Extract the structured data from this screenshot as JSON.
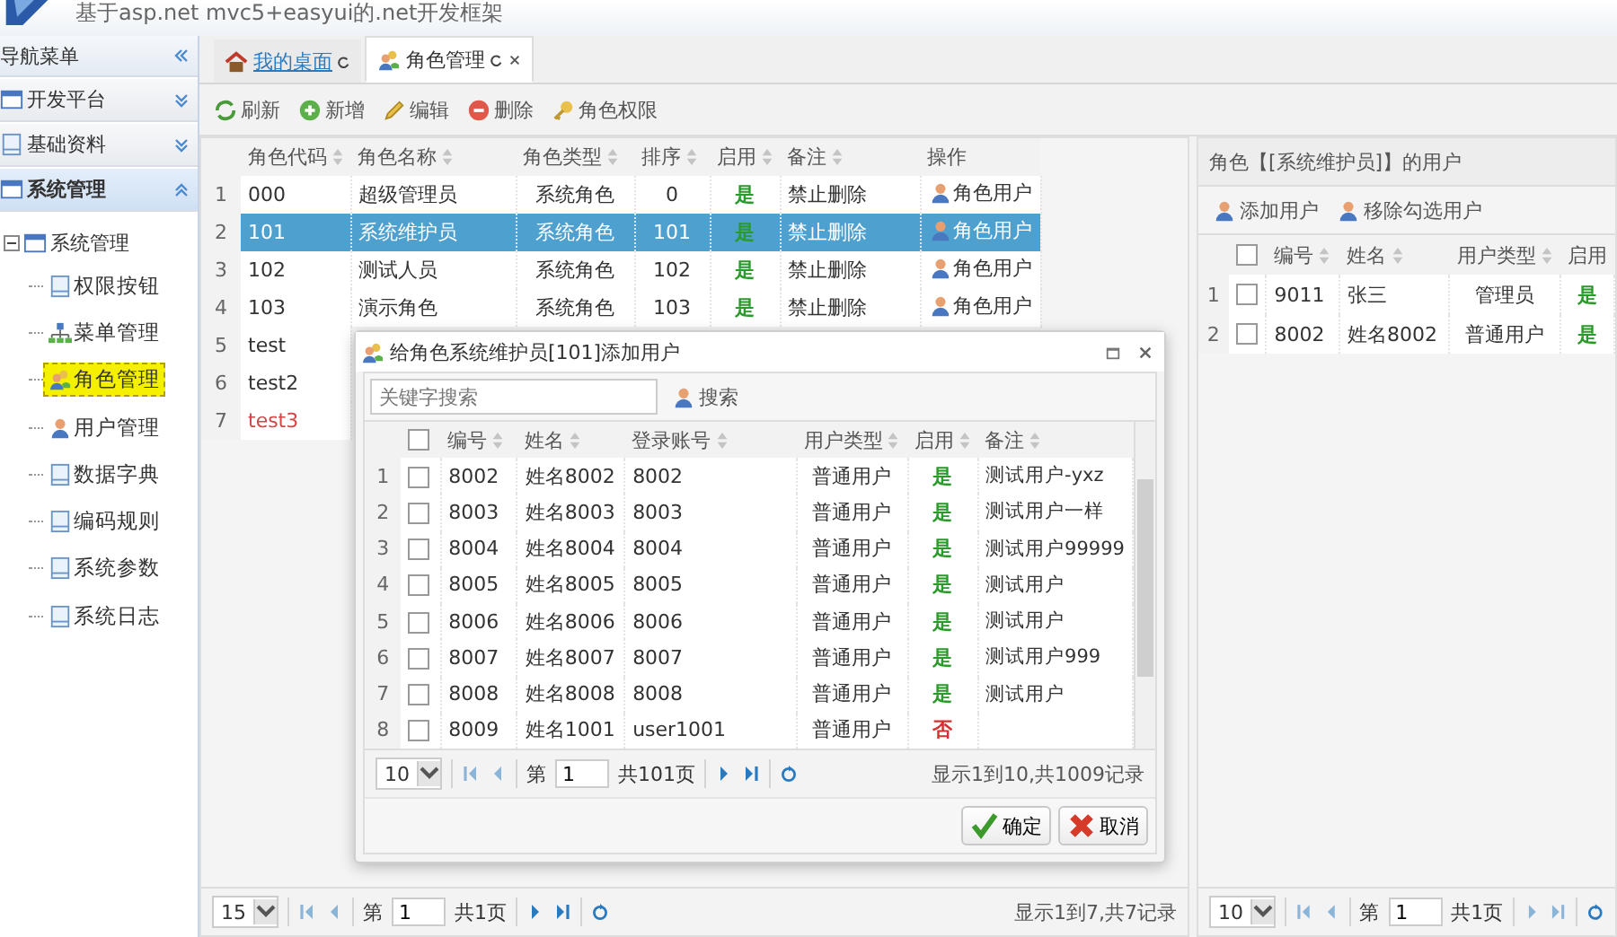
{
  "header": {
    "title": "基于asp.net mvc5+easyui的.net开发框架"
  },
  "sidebar": {
    "title": "导航菜单",
    "accordion": [
      {
        "label": "开发平台",
        "expanded": false
      },
      {
        "label": "基础资料",
        "expanded": false
      },
      {
        "label": "系统管理",
        "expanded": true
      }
    ],
    "tree": {
      "label": "系统管理",
      "expanded": true,
      "children": [
        {
          "label": "权限按钮",
          "selected": false
        },
        {
          "label": "菜单管理",
          "selected": false
        },
        {
          "label": "角色管理",
          "selected": true
        },
        {
          "label": "用户管理",
          "selected": false
        },
        {
          "label": "数据字典",
          "selected": false
        },
        {
          "label": "编码规则",
          "selected": false
        },
        {
          "label": "系统参数",
          "selected": false
        },
        {
          "label": "系统日志",
          "selected": false
        }
      ]
    }
  },
  "tabs": [
    {
      "label": "我的桌面",
      "selected": false,
      "closable": false
    },
    {
      "label": "角色管理",
      "selected": true,
      "closable": true
    }
  ],
  "toolbar": [
    "刷新",
    "新增",
    "编辑",
    "删除",
    "角色权限"
  ],
  "roles": {
    "columns": [
      "角色代码",
      "角色名称",
      "角色类型",
      "排序",
      "启用",
      "备注",
      "操作"
    ],
    "rows": [
      {
        "number": "1",
        "code": "000",
        "name": "超级管理员",
        "type": "系统角色",
        "order": "0",
        "enabled": {
          "text": "是",
          "on": true
        },
        "remark": "禁止删除",
        "action": "角色用户",
        "selected": false,
        "flagged": false
      },
      {
        "number": "2",
        "code": "101",
        "name": "系统维护员",
        "type": "系统角色",
        "order": "101",
        "enabled": {
          "text": "是",
          "on": true
        },
        "remark": "禁止删除",
        "action": "角色用户",
        "selected": true,
        "flagged": false
      },
      {
        "number": "3",
        "code": "102",
        "name": "测试人员",
        "type": "系统角色",
        "order": "102",
        "enabled": {
          "text": "是",
          "on": true
        },
        "remark": "禁止删除",
        "action": "角色用户",
        "selected": false,
        "flagged": false
      },
      {
        "number": "4",
        "code": "103",
        "name": "演示角色",
        "type": "系统角色",
        "order": "103",
        "enabled": {
          "text": "是",
          "on": true
        },
        "remark": "禁止删除",
        "action": "角色用户",
        "selected": false,
        "flagged": false
      },
      {
        "number": "5",
        "code": "test",
        "selected": false,
        "flagged": false
      },
      {
        "number": "6",
        "code": "test2",
        "selected": false,
        "flagged": false
      },
      {
        "number": "7",
        "code": "test3",
        "selected": false,
        "flagged": true
      }
    ],
    "pager": {
      "page_size": "15",
      "page_label": "第",
      "page": "1",
      "total_pages": "共1页",
      "summary": "显示1到7,共7记录"
    }
  },
  "users_panel": {
    "title": "角色【[系统维护员]】的用户",
    "toolbar": [
      "添加用户",
      "移除勾选用户"
    ],
    "columns": [
      "编号",
      "姓名",
      "用户类型",
      "启用"
    ],
    "header_checked": false,
    "rows": [
      {
        "number": "1",
        "checked": false,
        "id": "9011",
        "name": "张三",
        "type": "管理员",
        "enabled": {
          "text": "是",
          "on": true
        }
      },
      {
        "number": "2",
        "checked": false,
        "id": "8002",
        "name": "姓名8002",
        "type": "普通用户",
        "enabled": {
          "text": "是",
          "on": true
        }
      }
    ],
    "pager": {
      "page_size": "10",
      "page_label": "第",
      "page": "1",
      "total_pages": "共1页"
    }
  },
  "dialog": {
    "title": "给角色系统维护员[101]添加用户",
    "search": {
      "placeholder": "关键字搜索",
      "button": "搜索"
    },
    "columns": [
      "编号",
      "姓名",
      "登录账号",
      "用户类型",
      "启用",
      "备注"
    ],
    "header_checked": false,
    "rows": [
      {
        "number": "1",
        "checked": false,
        "id": "8002",
        "name": "姓名8002",
        "login": "8002",
        "type": "普通用户",
        "enabled": {
          "text": "是",
          "on": true
        },
        "remark": "测试用户-yxz"
      },
      {
        "number": "2",
        "checked": false,
        "id": "8003",
        "name": "姓名8003",
        "login": "8003",
        "type": "普通用户",
        "enabled": {
          "text": "是",
          "on": true
        },
        "remark": "测试用户一样"
      },
      {
        "number": "3",
        "checked": false,
        "id": "8004",
        "name": "姓名8004",
        "login": "8004",
        "type": "普通用户",
        "enabled": {
          "text": "是",
          "on": true
        },
        "remark": "测试用户99999"
      },
      {
        "number": "4",
        "checked": false,
        "id": "8005",
        "name": "姓名8005",
        "login": "8005",
        "type": "普通用户",
        "enabled": {
          "text": "是",
          "on": true
        },
        "remark": "测试用户"
      },
      {
        "number": "5",
        "checked": false,
        "id": "8006",
        "name": "姓名8006",
        "login": "8006",
        "type": "普通用户",
        "enabled": {
          "text": "是",
          "on": true
        },
        "remark": "测试用户"
      },
      {
        "number": "6",
        "checked": false,
        "id": "8007",
        "name": "姓名8007",
        "login": "8007",
        "type": "普通用户",
        "enabled": {
          "text": "是",
          "on": true
        },
        "remark": "测试用户999"
      },
      {
        "number": "7",
        "checked": false,
        "id": "8008",
        "name": "姓名8008",
        "login": "8008",
        "type": "普通用户",
        "enabled": {
          "text": "是",
          "on": true
        },
        "remark": "测试用户"
      },
      {
        "number": "8",
        "checked": false,
        "id": "8009",
        "name": "姓名1001",
        "login": "user1001",
        "type": "普通用户",
        "enabled": {
          "text": "否",
          "on": false
        },
        "remark": ""
      }
    ],
    "pager": {
      "page_size": "10",
      "page_label": "第",
      "page": "1",
      "total_pages": "共101页",
      "summary": "显示1到10,共1009记录"
    },
    "buttons": [
      "确定",
      "取消"
    ]
  }
}
